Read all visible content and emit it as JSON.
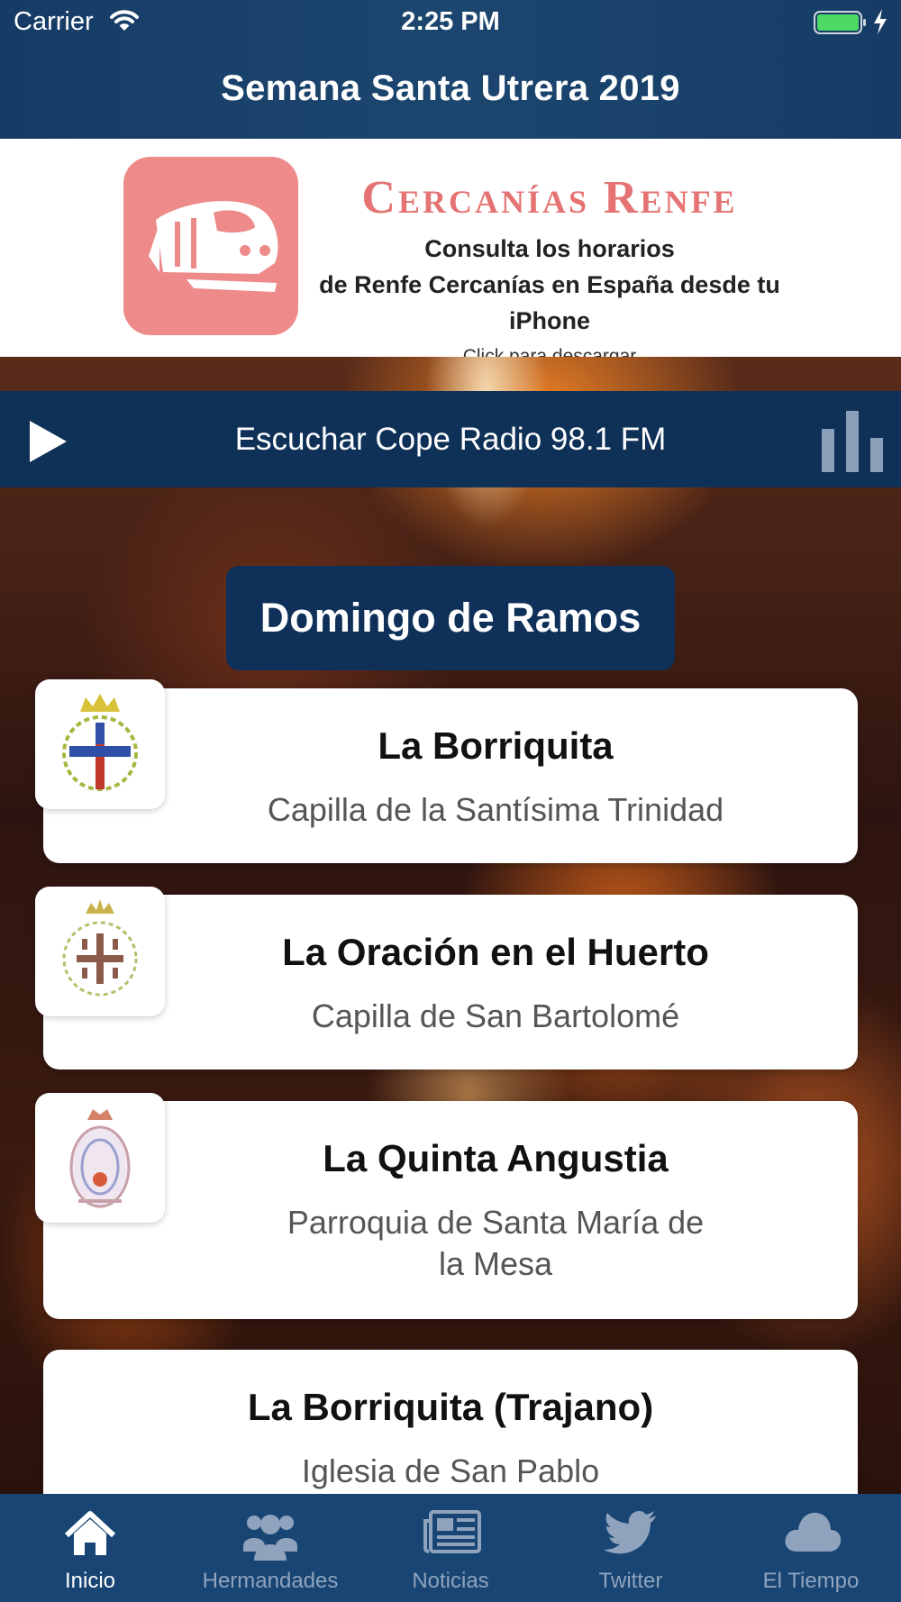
{
  "status_bar": {
    "carrier": "Carrier",
    "time": "2:25 PM"
  },
  "nav": {
    "title": "Semana Santa Utrera 2019"
  },
  "ad": {
    "brand": "Cercanías Renfe",
    "line1": "Consulta los horarios",
    "line2": "de Renfe Cercanías en España desde tu iPhone",
    "cta": "Click para descargar",
    "brand_color": "#e57373"
  },
  "radio": {
    "label": "Escuchar Cope Radio 98.1 FM",
    "play_icon": "play-icon",
    "bars_icon": "equalizer-icon"
  },
  "section": {
    "title": "Domingo de Ramos"
  },
  "hermandades": [
    {
      "name": "La Borriquita",
      "place": "Capilla de la Santísima Trinidad"
    },
    {
      "name": "La Oración en el Huerto",
      "place": "Capilla de San Bartolomé"
    },
    {
      "name": "La Quinta Angustia",
      "place_line1": "Parroquia de Santa María de",
      "place_line2": "la Mesa"
    },
    {
      "name": "La Borriquita (Trajano)",
      "place": "Iglesia de San Pablo"
    }
  ],
  "tabs": [
    {
      "label": "Inicio",
      "icon": "home-icon",
      "active": true
    },
    {
      "label": "Hermandades",
      "icon": "users-icon",
      "active": false
    },
    {
      "label": "Noticias",
      "icon": "newspaper-icon",
      "active": false
    },
    {
      "label": "Twitter",
      "icon": "twitter-icon",
      "active": false
    },
    {
      "label": "El Tiempo",
      "icon": "cloud-icon",
      "active": false
    }
  ],
  "colors": {
    "nav": "#163c66",
    "radio_bar": "#0f3158",
    "tabbar": "#184573",
    "tab_inactive": "#8fa3bd"
  }
}
